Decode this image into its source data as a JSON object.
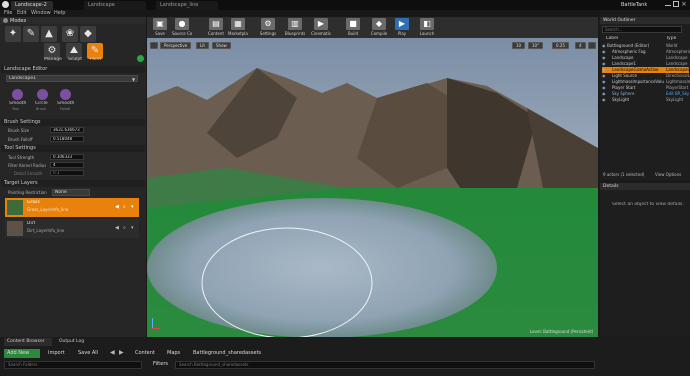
{
  "window": {
    "app_tab": "BattleTank",
    "tabs": [
      "Landscape",
      "Landscape_line",
      "Landscape-2"
    ]
  },
  "menu": [
    "File",
    "Edit",
    "Window",
    "Help"
  ],
  "modes": {
    "title": "Modes",
    "labels": [
      "Manage",
      "Sculpt",
      "Paint"
    ]
  },
  "landscape_editor": {
    "section": "Landscape Editor",
    "selected": "Landscape1",
    "tools": [
      "Smooth",
      "Circle",
      "Smooth"
    ],
    "tool_sub": [
      "Tool",
      "Brush",
      "Falloff"
    ]
  },
  "brush_settings": {
    "section": "Brush Settings",
    "rows": [
      {
        "label": "Brush Size",
        "value": "3631.636673"
      },
      {
        "label": "Brush Falloff",
        "value": "0.518048"
      }
    ]
  },
  "tool_settings": {
    "section": "Tool Settings",
    "rows": [
      {
        "label": "Tool Strength",
        "value": "0.306333"
      },
      {
        "label": "Filter Kernel Radius",
        "value": "4"
      },
      {
        "label": "Detail Smooth",
        "value": "0.3"
      }
    ]
  },
  "target_layers": {
    "section": "Target Layers",
    "painting_restriction_label": "Painting Restriction",
    "painting_restriction_value": "None",
    "layers": [
      {
        "name": "Grass",
        "file": "Grass_LayerInfo_line"
      },
      {
        "name": "Dirt",
        "file": "Dirt_LayerInfo_line"
      }
    ]
  },
  "toolbar": {
    "buttons": [
      {
        "label": "Save",
        "icon": "save-icon",
        "glyph": "▣"
      },
      {
        "label": "Source Control",
        "icon": "source-control-icon",
        "glyph": "●"
      },
      {
        "label": "Content",
        "icon": "content-icon",
        "glyph": "▤"
      },
      {
        "label": "Marketplace",
        "icon": "marketplace-icon",
        "glyph": "▦"
      },
      {
        "label": "Settings",
        "icon": "gear-icon",
        "glyph": "⚙"
      },
      {
        "label": "Blueprints",
        "icon": "blueprint-icon",
        "glyph": "▥"
      },
      {
        "label": "Cinematics",
        "icon": "cinematics-icon",
        "glyph": "▶"
      },
      {
        "label": "Build",
        "icon": "build-icon",
        "glyph": "■"
      },
      {
        "label": "Compile",
        "icon": "compile-icon",
        "glyph": "◆"
      },
      {
        "label": "Play",
        "icon": "play-icon",
        "glyph": "▶"
      },
      {
        "label": "Launch",
        "icon": "launch-icon",
        "glyph": "◧"
      }
    ]
  },
  "viewport": {
    "perspective": "Perspective",
    "lit": "Lit",
    "show": "Show",
    "right_controls": [
      "10",
      "10°",
      "0.25",
      "4"
    ],
    "level_label": "Level: Battleground (Persistent)"
  },
  "world_outliner": {
    "title": "World Outliner",
    "search_placeholder": "Search...",
    "col_label": "Label",
    "col_type": "Type",
    "rows": [
      {
        "label": "Battleground (Editor)",
        "type": "World",
        "selected": false
      },
      {
        "label": "Atmospheric Fog",
        "type": "AtmosphericFog",
        "selected": false
      },
      {
        "label": "Landscape",
        "type": "Landscape",
        "selected": false
      },
      {
        "label": "Landscape1",
        "type": "Landscape",
        "selected": false
      },
      {
        "label": "LandscapeGizmoActive",
        "type": "LandscapeGizmo",
        "selected": true
      },
      {
        "label": "Light Source",
        "type": "DirectionalL",
        "selected": false
      },
      {
        "label": "LightmassImportanceVolume",
        "type": "LightmassImpo",
        "selected": false
      },
      {
        "label": "Player Start",
        "type": "PlayerStart",
        "selected": false
      },
      {
        "label": "Sky Sphere",
        "type": "Edit BP_Sky",
        "selected": false
      },
      {
        "label": "SkyLight",
        "type": "SkyLight",
        "selected": false
      }
    ],
    "status": "9 actors (1 selected)",
    "view_options": "View Options"
  },
  "details": {
    "title": "Details",
    "empty_text": "Select an object to view details."
  },
  "bottom": {
    "tabs": [
      "Content Browser",
      "Output Log"
    ],
    "add_new": "Add New",
    "import": "Import",
    "save_all": "Save All",
    "path": [
      "Content",
      "Maps",
      "Battleground_sharedassets"
    ],
    "filters": "Filters",
    "search_folders": "Search Folders",
    "search_assets": "Search Battleground_sharedassets"
  },
  "colors": {
    "accent_orange": "#e8820c",
    "selection_blue": "#1f5fa8",
    "grass_green": "#1f8a36"
  }
}
